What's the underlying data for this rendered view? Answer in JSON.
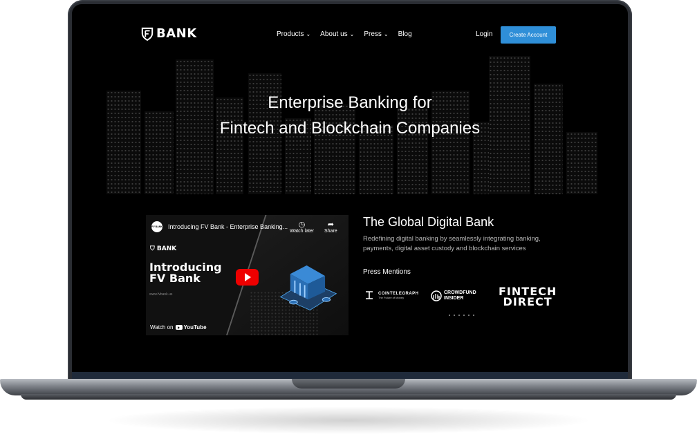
{
  "nav": {
    "logo_text": "BANK",
    "menu": [
      {
        "label": "Products",
        "has_dropdown": true
      },
      {
        "label": "About us",
        "has_dropdown": true
      },
      {
        "label": "Press",
        "has_dropdown": true
      },
      {
        "label": "Blog",
        "has_dropdown": false
      }
    ],
    "login_label": "Login",
    "cta_label": "Create Account"
  },
  "hero": {
    "line1": "Enterprise Banking for",
    "line2": "Fintech and Blockchain Companies"
  },
  "video": {
    "channel_avatar": "FV BANK",
    "title": "Introducing FV Bank - Enterprise Banking...",
    "watch_later_label": "Watch later",
    "share_label": "Share",
    "brand_text": "BANK",
    "headline_line1": "Introducing",
    "headline_line2": "FV Bank",
    "url_text": "www.fvbank.us",
    "watch_on_label": "Watch on",
    "youtube_label": "YouTube"
  },
  "about": {
    "title": "The Global Digital Bank",
    "description": "Redefining digital banking by seamlessly integrating banking, payments, digital asset custody and blockchain services"
  },
  "press": {
    "heading": "Press Mentions",
    "logos": [
      {
        "name": "COINTELEGRAPH",
        "tagline": "The Future of Money"
      },
      {
        "name": "CROWDFUND",
        "name2": "INSIDER"
      },
      {
        "name": "FINTECH",
        "name2": "DIRECT"
      }
    ]
  },
  "colors": {
    "accent": "#2f8fd8",
    "background": "#000000",
    "youtube_red": "#ee0000"
  },
  "icons": [
    "fv-shield-logo-icon",
    "chevron-down-icon",
    "clock-icon",
    "share-icon",
    "play-icon",
    "youtube-icon",
    "bank-building-icon"
  ]
}
